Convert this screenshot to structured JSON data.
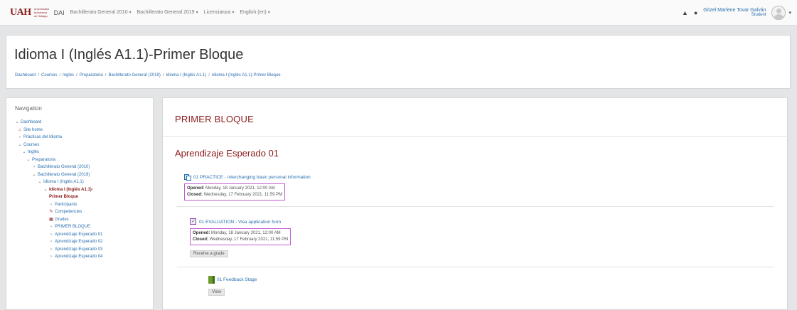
{
  "navbar": {
    "logo": "UAH",
    "logo_sub": "Universidad Autónoma de Hidalgo",
    "brand": "DAI",
    "menu": [
      "Bachillerato General 2010",
      "Bachillerato General 2019",
      "Licenciatura",
      "English (en)"
    ],
    "user_name": "Gitzel Marlene Tovar Galván",
    "user_role": "Student"
  },
  "header": {
    "title": "Idioma I (Inglés A1.1)-Primer Bloque",
    "breadcrumb": [
      "Dashboard",
      "Courses",
      "Inglés",
      "Preparatoria",
      "Bachillerato General (2019)",
      "Idioma I (Inglés A1.1)",
      "Idioma I (Inglés A1.1)-Primer Bloque"
    ]
  },
  "navigation": {
    "title": "Navigation",
    "items": [
      {
        "label": "Dashboard",
        "glyph": "⌄"
      },
      {
        "label": "Site home",
        "glyph": "⌂"
      },
      {
        "label": "Prácticas del Idioma",
        "glyph": "›"
      },
      {
        "label": "Courses",
        "glyph": "⌄"
      },
      {
        "label": "Inglés",
        "glyph": "⌄"
      },
      {
        "label": "Preparatoria",
        "glyph": "⌄"
      },
      {
        "label": "Bachillerato General (2010)",
        "glyph": "›"
      },
      {
        "label": "Bachillerato General (2019)",
        "glyph": "⌄"
      },
      {
        "label": "Idioma I (Inglés A1.1)",
        "glyph": "⌄"
      },
      {
        "label": "Idioma I (Inglés A1.1)-",
        "glyph": "⌄"
      },
      {
        "label": "Primer Bloque",
        "glyph": ""
      },
      {
        "label": "Participants",
        "glyph": "›"
      },
      {
        "label": "Competencies",
        "glyph": "✎"
      },
      {
        "label": "Grades",
        "glyph": "▦"
      },
      {
        "label": "PRIMER BLOQUE",
        "glyph": "›"
      },
      {
        "label": "Aprendizaje Esperado 01",
        "glyph": "›"
      },
      {
        "label": "Aprendizaje Esperado 02",
        "glyph": "›"
      },
      {
        "label": "Aprendizaje Esperado 03",
        "glyph": "›"
      },
      {
        "label": "Aprendizaje Esperado 04",
        "glyph": "›"
      }
    ]
  },
  "main": {
    "section_title": "PRIMER BLOQUE",
    "subsection_title": "Aprendizaje Esperado 01",
    "activities": [
      {
        "title": "01 PRACTICE - Interchanging basic personal information",
        "opened_label": "Opened:",
        "opened_value": "Monday, 18 January 2021, 12:00 AM",
        "closed_label": "Closed:",
        "closed_value": "Wednesday, 17 February 2021, 11:59 PM"
      },
      {
        "title": "01 EVALUATION - Visa application form",
        "opened_label": "Opened:",
        "opened_value": "Monday, 18 January 2021, 12:00 AM",
        "closed_label": "Closed:",
        "closed_value": "Wednesday, 17 February 2021, 11:59 PM",
        "button": "Receive a grade"
      },
      {
        "title": "01 Feedback Stage",
        "button": "View"
      }
    ]
  },
  "colors": {
    "accent": "#8b1a1a",
    "link": "#2a6fb0",
    "highlight_box": "#c25bd4"
  }
}
